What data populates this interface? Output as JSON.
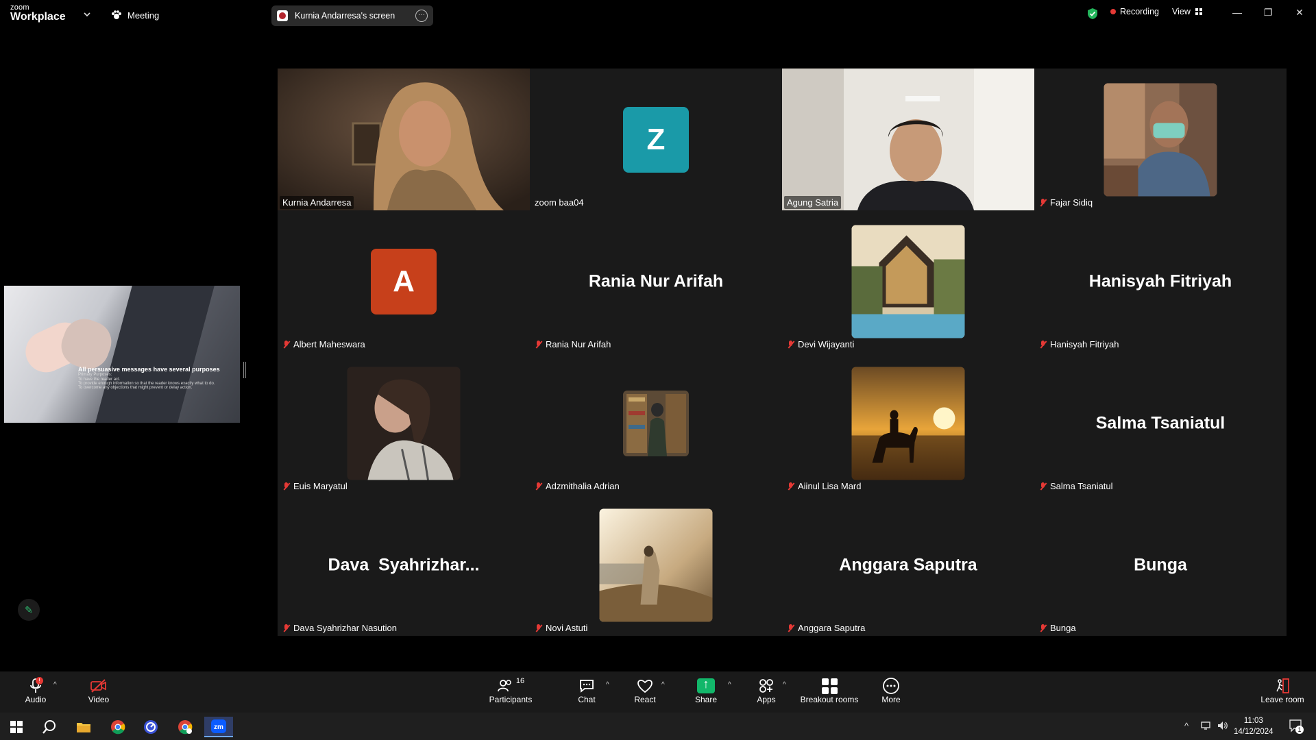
{
  "titlebar": {
    "logo_line1": "zoom",
    "logo_line2": "Workplace",
    "meeting_label": "Meeting",
    "shared_screen_label": "Kurnia Andarresa's screen",
    "recording_label": "Recording",
    "view_label": "View"
  },
  "participants": [
    {
      "name": "Kurnia Andarresa",
      "type": "video",
      "muted": false,
      "active_speaker": true
    },
    {
      "name": "zoom baa04",
      "type": "avatar",
      "initial": "Z",
      "avatar_color": "#1a9aa8",
      "muted": false
    },
    {
      "name": "Agung Satria",
      "type": "video",
      "muted": false
    },
    {
      "name": "Fajar Sidiq",
      "type": "photo",
      "muted": true
    },
    {
      "name": "Albert Maheswara",
      "type": "avatar",
      "initial": "A",
      "avatar_color": "#c7401b",
      "muted": true
    },
    {
      "name": "Rania Nur Arifah",
      "type": "name",
      "display": "Rania Nur Arifah",
      "muted": true
    },
    {
      "name": "Devi Wijayanti",
      "type": "photo",
      "muted": true
    },
    {
      "name": "Hanisyah Fitriyah",
      "type": "name",
      "display": "Hanisyah Fitriyah",
      "muted": true
    },
    {
      "name": "Euis Maryatul",
      "type": "photo",
      "muted": true
    },
    {
      "name": "Adzmithalia Adrian",
      "type": "photo",
      "muted": true
    },
    {
      "name": "Aiinul Lisa Mard",
      "type": "photo",
      "muted": true
    },
    {
      "name": "Salma Tsaniatul",
      "type": "name",
      "display": "Salma Tsaniatul",
      "muted": true
    },
    {
      "name": "Dava Syahrizhar Nasution",
      "type": "name",
      "display": "Dava  Syahrizhar...",
      "muted": true
    },
    {
      "name": "Novi Astuti",
      "type": "photo",
      "muted": true
    },
    {
      "name": "Anggara Saputra",
      "type": "name",
      "display": "Anggara Saputra",
      "muted": true
    },
    {
      "name": "Bunga",
      "type": "name",
      "display": "Bunga",
      "muted": true
    }
  ],
  "shared_slide": {
    "heading": "All persuasive messages have several purposes",
    "sub": "Primary Purposes:",
    "bullets": [
      "To have the reader act.",
      "To provide enough information so that the reader knows exactly what to do.",
      "To overcome any objections that might prevent or delay action."
    ]
  },
  "toolbar": {
    "audio": "Audio",
    "video": "Video",
    "participants": "Participants",
    "participants_count": "16",
    "chat": "Chat",
    "react": "React",
    "share": "Share",
    "apps": "Apps",
    "breakout": "Breakout rooms",
    "more": "More",
    "leave": "Leave room",
    "audio_badge": "!"
  },
  "taskbar": {
    "time": "11:03",
    "date": "14/12/2024",
    "notifications_count": "1"
  },
  "colors": {
    "active_speaker_border": "#23d18b",
    "share_green": "#12b76a",
    "mute_red": "#e53935"
  }
}
